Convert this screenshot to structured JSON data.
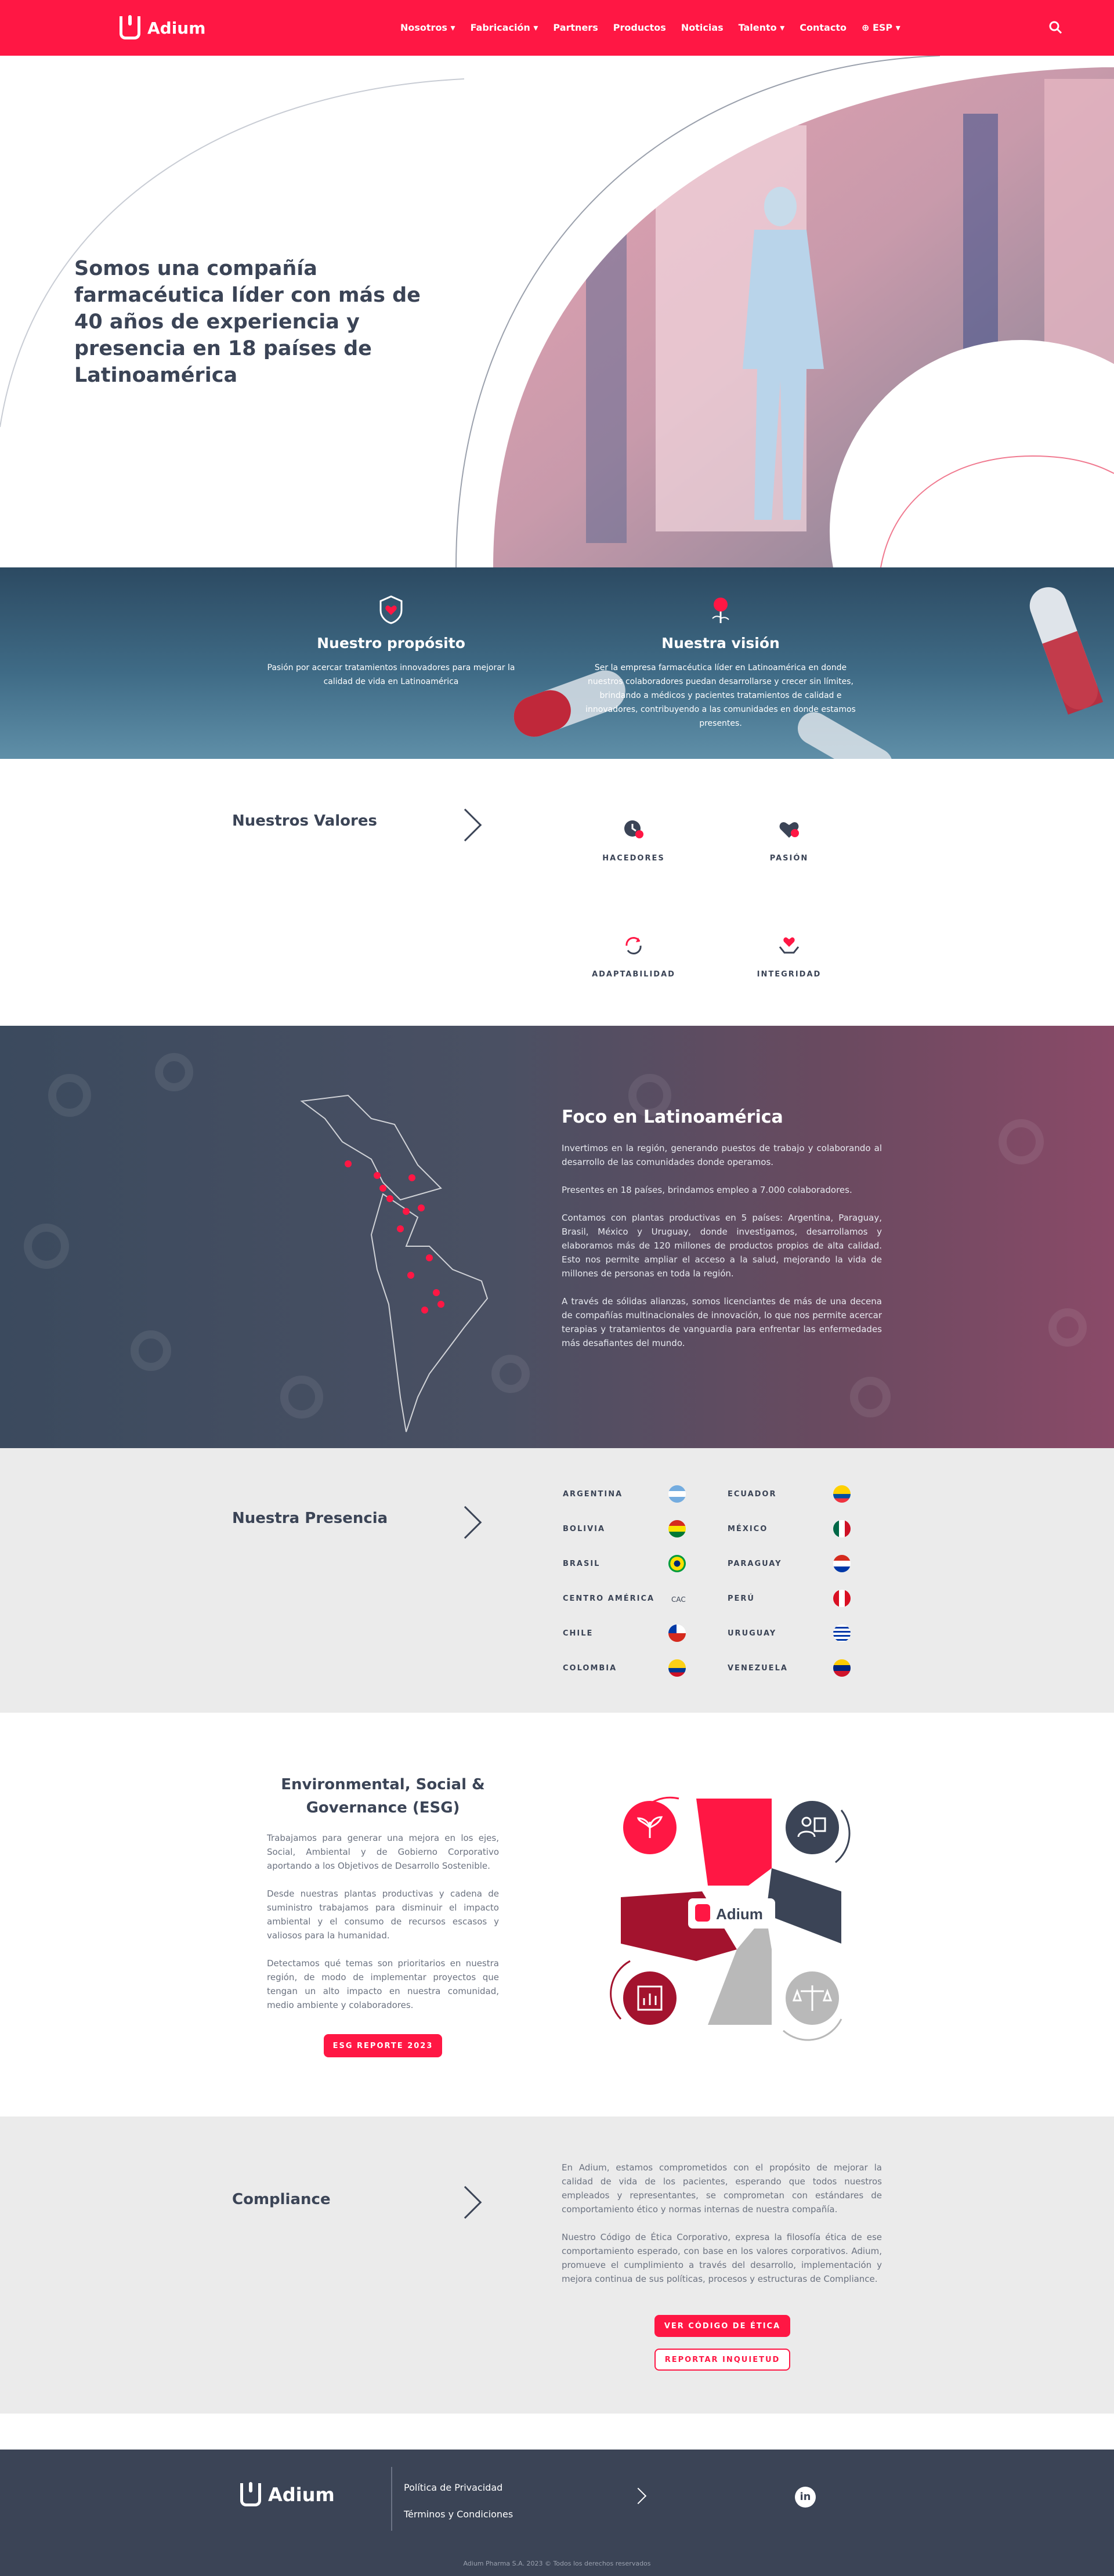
{
  "header": {
    "brand": "Adium",
    "nav": [
      "Nosotros",
      "Fabricación",
      "Partners",
      "Productos",
      "Noticias",
      "Talento",
      "Contacto",
      "ESP"
    ],
    "icons": {
      "search": "search-icon",
      "globe": "globe-icon"
    }
  },
  "hero": {
    "title": "Somos una compañía farmacéutica líder con más de 40 años de experiencia y presencia en 18 países de Latinoamérica"
  },
  "purpose": {
    "title": "Nuestro propósito",
    "text": "Pasión por acercar tratamientos innovadores para mejorar la calidad de vida en Latinoamérica"
  },
  "vision": {
    "title": "Nuestra visión",
    "text": "Ser la empresa farmacéutica líder en Latinoamérica en donde nuestros colaboradores puedan desarrollarse y crecer sin límites, brindando a médicos y pacientes tratamientos de calidad e innovadores, contribuyendo a las comunidades en donde estamos presentes."
  },
  "values": {
    "title": "Nuestros Valores",
    "items": [
      "HACEDORES",
      "PASIÓN",
      "ADAPTABILIDAD",
      "INTEGRIDAD"
    ]
  },
  "focus": {
    "title": "Foco en Latinoamérica",
    "paragraphs": [
      "Invertimos en la región, generando puestos de trabajo y colaborando al desarrollo de las comunidades donde operamos.",
      "Presentes en 18 países, brindamos empleo a 7.000 colaboradores.",
      "Contamos con plantas productivas en 5 países: Argentina, Paraguay, Brasil, México y Uruguay, donde investigamos, desarrollamos y elaboramos más de 120 millones de productos propios de alta calidad. Esto nos permite ampliar el acceso a la salud, mejorando la vida de millones de personas en toda la región.",
      "A través de sólidas alianzas, somos licenciantes de más de una decena de compañías multinacionales de innovación, lo que nos permite acercar terapias y tratamientos de vanguardia para enfrentar las enfermedades más desafiantes del mundo."
    ]
  },
  "presence": {
    "title": "Nuestra Presencia",
    "left": [
      "ARGENTINA",
      "BOLIVIA",
      "BRASIL",
      "CENTRO AMÉRICA",
      "CHILE",
      "COLOMBIA"
    ],
    "right": [
      "ECUADOR",
      "MÉXICO",
      "PARAGUAY",
      "PERÚ",
      "URUGUAY",
      "VENEZUELA"
    ],
    "cac": "CAC"
  },
  "esg": {
    "title": "Environmental, Social & Governance (ESG)",
    "paragraphs": [
      "Trabajamos para generar una mejora en los ejes, Social, Ambiental y de Gobierno Corporativo aportando a los Objetivos de Desarrollo Sostenible.",
      "Desde nuestras plantas productivas y cadena de suministro trabajamos para disminuir el impacto ambiental y el consumo de recursos escasos y valiosos para la humanidad.",
      "Detectamos qué temas son prioritarios en nuestra región, de modo de implementar proyectos que tengan un alto impacto en nuestra comunidad, medio ambiente y colaboradores."
    ],
    "button": "ESG REPORTE 2023",
    "diagram_brand": "Adium"
  },
  "compliance": {
    "title": "Compliance",
    "paragraphs": [
      "En Adium, estamos comprometidos con el propósito de mejorar la calidad de vida de los pacientes, esperando que todos nuestros empleados y representantes, se comprometan con estándares de comportamiento ético y normas internas de nuestra compañía.",
      "Nuestro Código de Ética Corporativo, expresa la filosofía ética de ese comportamiento esperado, con base en los valores corporativos. Adium, promueve el cumplimiento a través del desarrollo, implementación y mejora continua de sus políticas, procesos y estructuras de Compliance."
    ],
    "button_primary": "VER CÓDIGO DE ÉTICA",
    "button_secondary": "REPORTAR INQUIETUD"
  },
  "footer": {
    "brand": "Adium",
    "links": [
      "Política de Privacidad",
      "Términos y Condiciones"
    ],
    "copyright": "Adium Pharma S.A. 2023 © Todos los derechos reservados",
    "social": "linkedin-icon"
  },
  "colors": {
    "brand": "#ff1744",
    "navy": "#3b4456",
    "grey": "#ebebeb"
  }
}
